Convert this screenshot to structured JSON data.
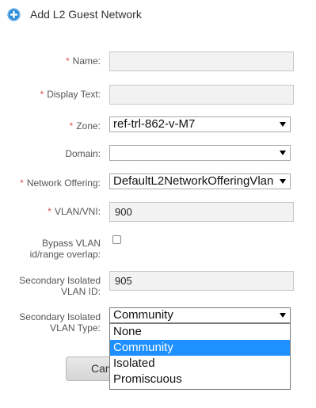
{
  "header": {
    "title": "Add L2 Guest Network",
    "icon": "plus-circle-icon",
    "icon_color": "#2e8bd8"
  },
  "required_marker": "*",
  "fields": {
    "name": {
      "label": "Name:",
      "value": ""
    },
    "display_text": {
      "label": "Display Text:",
      "value": ""
    },
    "zone": {
      "label": "Zone:",
      "value": "ref-trl-862-v-M7"
    },
    "domain": {
      "label": "Domain:",
      "value": ""
    },
    "network_offering": {
      "label": "Network Offering:",
      "value": "DefaultL2NetworkOfferingVlan"
    },
    "vlan_vni": {
      "label": "VLAN/VNI:",
      "value": "900"
    },
    "bypass_vlan": {
      "label_line1": "Bypass VLAN",
      "label_line2": "id/range overlap:",
      "checked": false
    },
    "secondary_vlan_id": {
      "label_line1": "Secondary Isolated",
      "label_line2": "VLAN ID:",
      "value": "905"
    },
    "secondary_vlan_type": {
      "label_line1": "Secondary Isolated",
      "label_line2": "VLAN Type:",
      "value": "Community",
      "options": [
        "None",
        "Community",
        "Isolated",
        "Promiscuous"
      ],
      "highlighted_option": "Community"
    }
  },
  "buttons": {
    "cancel_label": "Cancel"
  },
  "colors": {
    "required": "#d9534f",
    "highlight": "#1e90ff",
    "input_background": "#f2f2f2"
  }
}
